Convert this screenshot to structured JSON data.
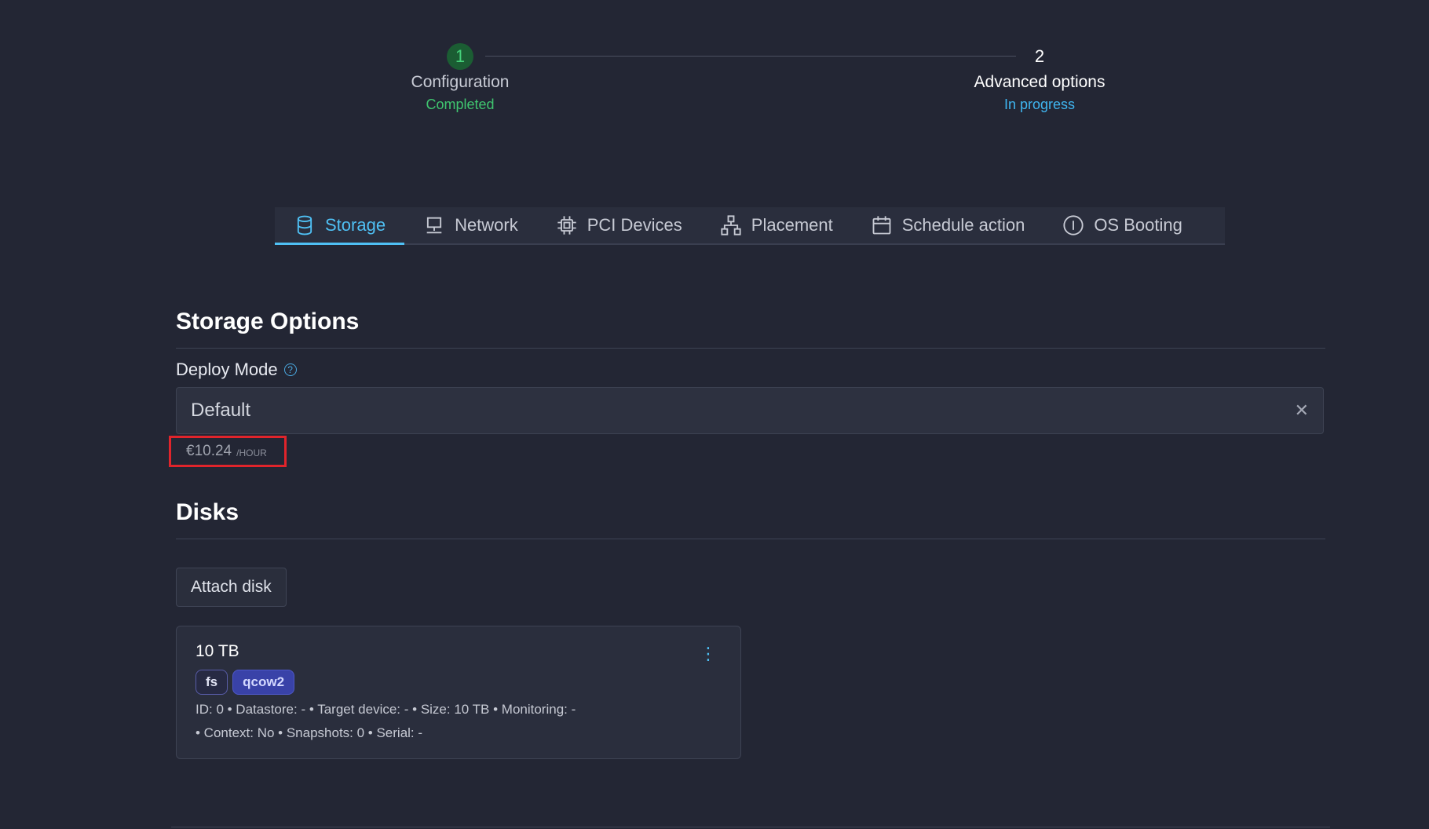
{
  "stepper": {
    "steps": [
      {
        "number": "1",
        "title": "Configuration",
        "status": "Completed"
      },
      {
        "number": "2",
        "title": "Advanced options",
        "status": "In progress"
      }
    ]
  },
  "tabs": [
    {
      "label": "Storage",
      "icon": "database-icon",
      "active": true
    },
    {
      "label": "Network",
      "icon": "network-icon",
      "active": false
    },
    {
      "label": "PCI Devices",
      "icon": "chip-icon",
      "active": false
    },
    {
      "label": "Placement",
      "icon": "hierarchy-icon",
      "active": false
    },
    {
      "label": "Schedule action",
      "icon": "calendar-icon",
      "active": false
    },
    {
      "label": "OS Booting",
      "icon": "info-icon",
      "active": false
    }
  ],
  "storage_options": {
    "heading": "Storage Options",
    "deploy_mode_label": "Deploy Mode",
    "deploy_mode_value": "Default",
    "clear_symbol": "✕",
    "price": "€10.24",
    "price_unit": "/HOUR"
  },
  "disks": {
    "heading": "Disks",
    "attach_label": "Attach disk",
    "items": [
      {
        "title": "10 TB",
        "tags": [
          "fs",
          "qcow2"
        ],
        "meta_line1": "ID: 0 • Datastore: - • Target device: - • Size: 10 TB • Monitoring: -",
        "meta_line2": "• Context: No • Snapshots: 0 • Serial: -"
      }
    ]
  },
  "colors": {
    "background": "#232634",
    "accent": "#4fc0f4",
    "success": "#3fc56f",
    "highlight_box": "#e0242b"
  }
}
